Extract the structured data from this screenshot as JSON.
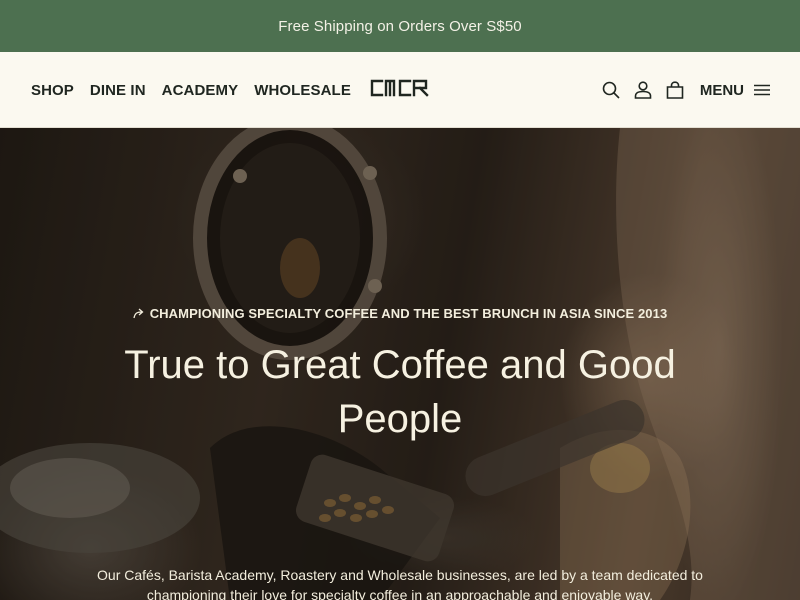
{
  "announcement": {
    "text": "Free Shipping on Orders Over S$50"
  },
  "header": {
    "nav": [
      "SHOP",
      "DINE IN",
      "ACADEMY",
      "WHOLESALE"
    ],
    "logo_text": "CMCR",
    "menu_label": "MENU",
    "icons": [
      "search-icon",
      "account-icon",
      "cart-icon",
      "hamburger-icon"
    ]
  },
  "hero": {
    "eyebrow": "CHAMPIONING SPECIALTY COFFEE AND THE BEST BRUNCH IN ASIA SINCE 2013",
    "headline": "True to Great Coffee and Good People",
    "subtext": "Our Cafés, Barista Academy, Roastery and Wholesale businesses, are led by a team dedicated to championing their love for specialty coffee in an approachable and enjoyable way."
  },
  "colors": {
    "announcement_bg": "#4d7050",
    "header_bg": "#fbf9f0",
    "text_dark": "#1f2620",
    "hero_text": "#f6f1e1"
  }
}
